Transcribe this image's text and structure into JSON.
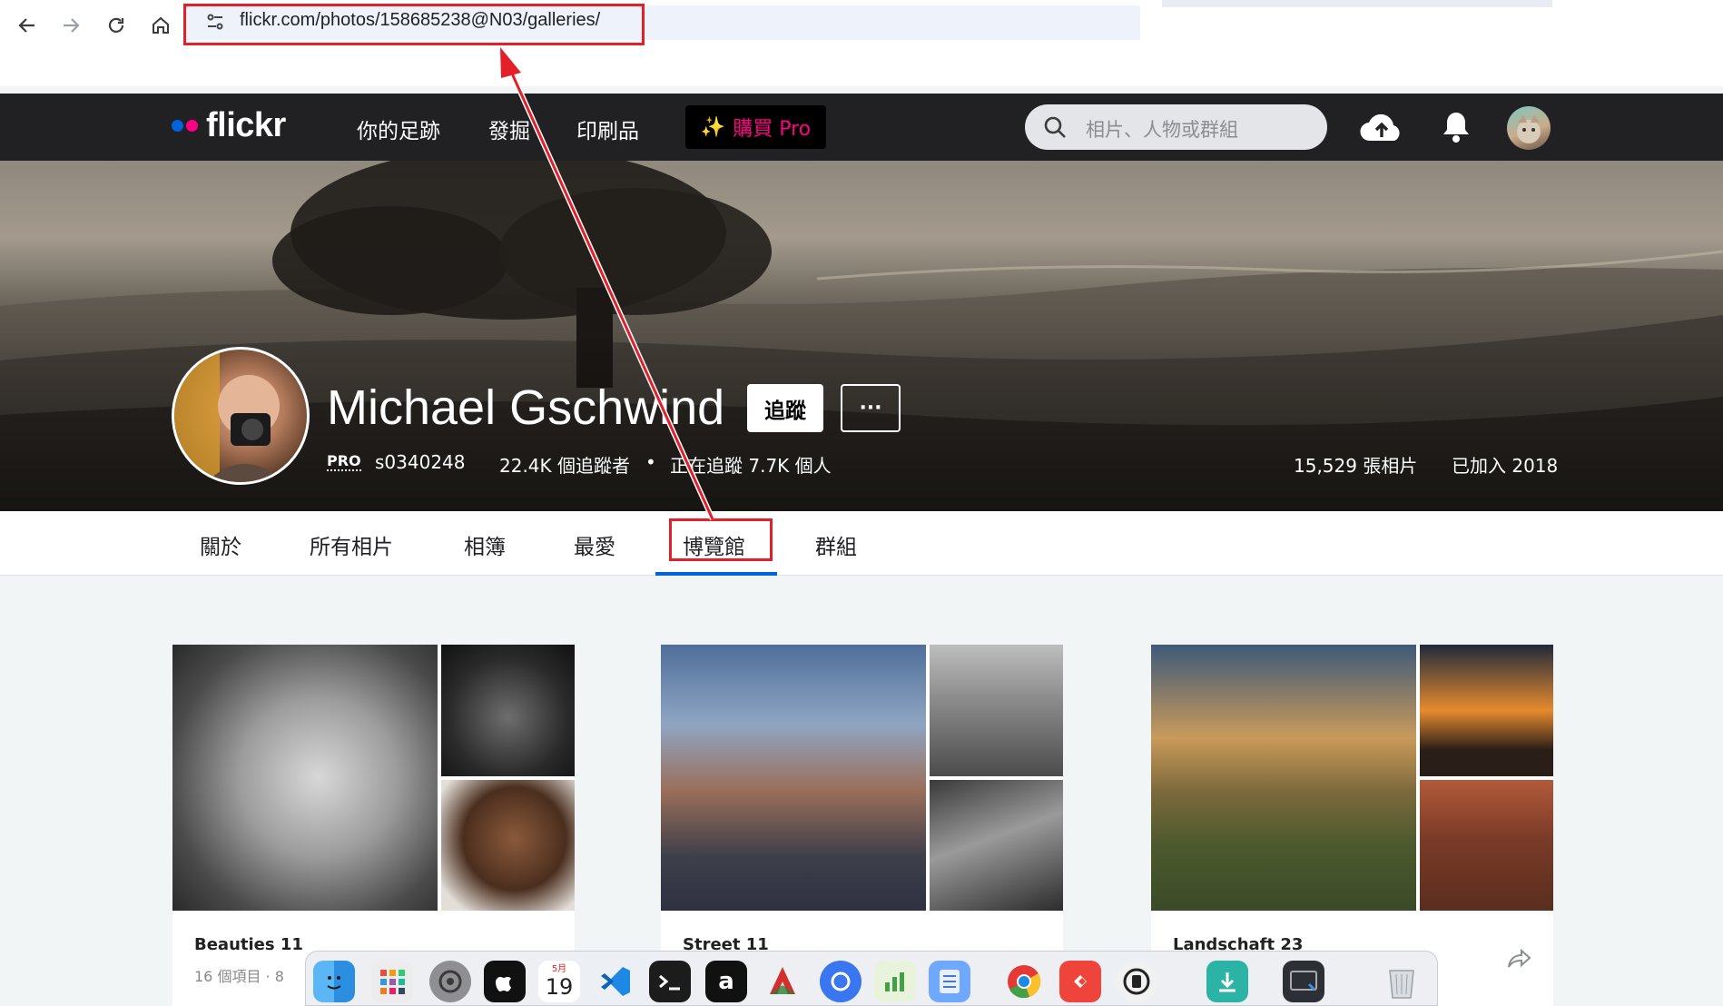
{
  "browser": {
    "url": "flickr.com/photos/158685238@N03/galleries/"
  },
  "flickr_nav": {
    "logo_text": "flickr",
    "links": [
      "你的足跡",
      "發掘",
      "印刷品"
    ],
    "buy_pro": {
      "spark": "✨",
      "label": "購買 Pro"
    },
    "search_placeholder": "相片、人物或群組",
    "colors": {
      "dot_blue": "#0063dc",
      "dot_pink": "#ff0084",
      "pro_pink": "#ff0084"
    }
  },
  "profile": {
    "name": "Michael Gschwind",
    "follow_label": "追蹤",
    "more_label": "···",
    "pro_badge": "PRO",
    "username": "s0340248",
    "followers": "22.4K 個追蹤者",
    "separator": "•",
    "following": "正在追蹤 7.7K 個人",
    "photos": "15,529 張相片",
    "joined": "已加入 2018"
  },
  "tabs": [
    "關於",
    "所有相片",
    "相簿",
    "最愛",
    "博覽館",
    "群組"
  ],
  "active_tab": "博覽館",
  "galleries": [
    {
      "title": "Beauties 11",
      "subtitle": "16 個項目 · 8"
    },
    {
      "title": "Street 11",
      "subtitle": ""
    },
    {
      "title": "Landschaft 23",
      "subtitle": ""
    }
  ],
  "dock": {
    "calendar_month": "5月",
    "calendar_day": "19",
    "apps": [
      "finder",
      "launchpad",
      "system-settings",
      "apple-music",
      "calendar",
      "vscode",
      "terminal",
      "app-a",
      "app-wps",
      "app-circle",
      "app-chart",
      "notes",
      "chrome",
      "anydesk",
      "app-vpn",
      "downloads",
      "app-window",
      "trash"
    ]
  }
}
